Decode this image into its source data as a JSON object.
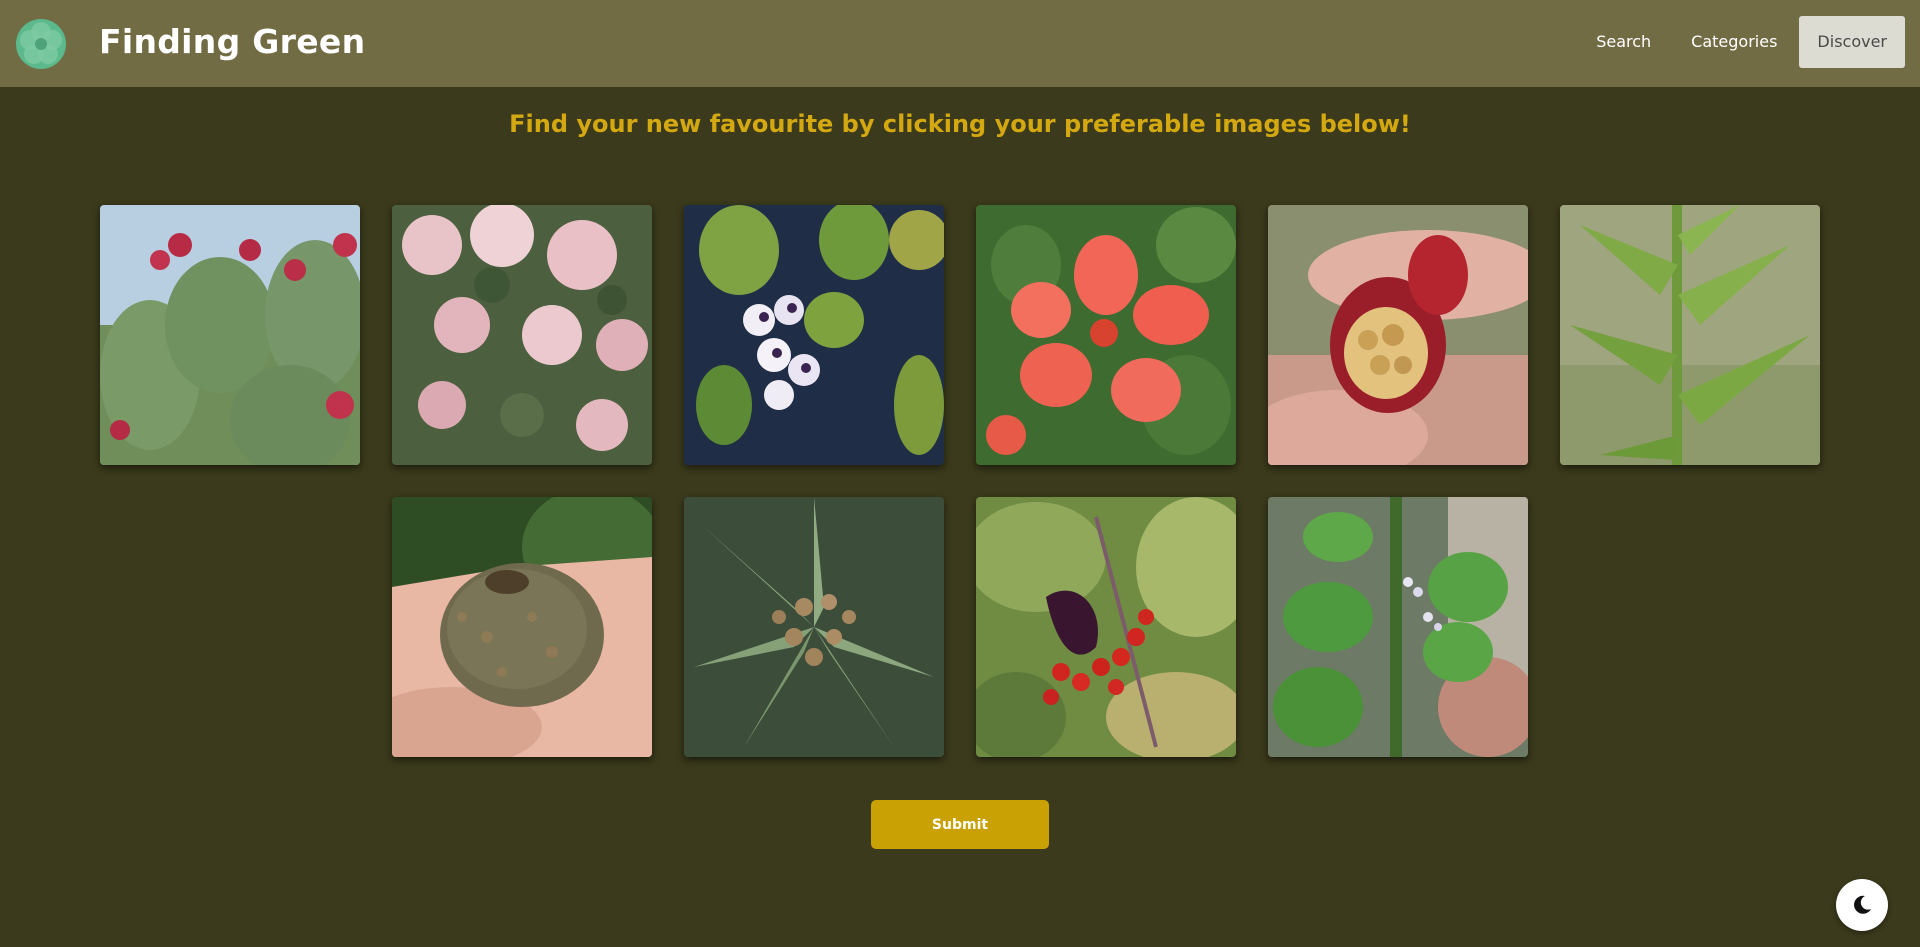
{
  "header": {
    "brand": "Finding Green",
    "nav": [
      {
        "label": "Search",
        "active": false
      },
      {
        "label": "Categories",
        "active": false
      },
      {
        "label": "Discover",
        "active": true
      }
    ]
  },
  "main": {
    "heading": "Find your new favourite by clicking your preferable images below!",
    "images": [
      {
        "subject": "prickly pear cactus with red fruit"
      },
      {
        "subject": "pink flowering shrub"
      },
      {
        "subject": "white and purple water hyacinth flowers"
      },
      {
        "subject": "red-orange five-petal flower"
      },
      {
        "subject": "hand holding red fruit with seeds"
      },
      {
        "subject": "green leafy stem"
      },
      {
        "subject": "hand holding round brown fruit"
      },
      {
        "subject": "rosette of leaves with flower buds"
      },
      {
        "subject": "red berries with dark pods"
      },
      {
        "subject": "green leaves with small white flowers"
      }
    ],
    "submit_label": "Submit"
  },
  "theme_toggle": {
    "icon": "moon-icon"
  },
  "colors": {
    "navbar": "#726c45",
    "background": "#3b3a1c",
    "heading": "#d4a810",
    "submit": "#c9a105"
  }
}
